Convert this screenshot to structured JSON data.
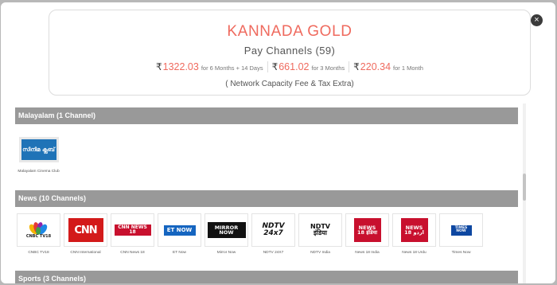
{
  "pack": {
    "title": "KANNADA GOLD",
    "subtitle": "Pay Channels (59)",
    "prices": [
      {
        "symbol": "₹",
        "amount": "1322.03",
        "period": "for 6 Months + 14 Days"
      },
      {
        "symbol": "₹",
        "amount": "661.02",
        "period": "for 3 Months"
      },
      {
        "symbol": "₹",
        "amount": "220.34",
        "period": "for 1 Month"
      }
    ],
    "note": "( Network Capacity Fee & Tax Extra)"
  },
  "close_icon": "×",
  "sections": [
    {
      "title": "Malayalam  (1 Channel)",
      "channels": [
        "Malayalam Cinema Club"
      ]
    },
    {
      "title": "News  (10 Channels)",
      "channels": [
        "CNBC TV18",
        "CNN International",
        "CNN News 18",
        "ET Now",
        "Mirror Now",
        "NDTV 24X7",
        "NDTV India",
        "News 18 India",
        "News 18 Urdu",
        "Times Now"
      ]
    },
    {
      "title": "Sports  (3 Channels)",
      "channels": []
    }
  ],
  "logos": {
    "malayalam": "സിനിമ ക്ലബ്",
    "cnbc": "CNBC TV18",
    "cnn": "CNN",
    "cnn18": "CNN NEWS 18",
    "etnow": "ET NOW",
    "mirror": "MIRROR NOW",
    "ndtv24": "NDTV 24x7",
    "ndtvindia": "NDTV इंडिया",
    "n18india": "NEWS 18 इंडिया",
    "n18urdu": "NEWS 18 اردو",
    "times": "TIMES NOW"
  },
  "colors": {
    "accent": "#ef6a5e",
    "section_bg": "#999999",
    "overlay": "#b8b8b8"
  }
}
